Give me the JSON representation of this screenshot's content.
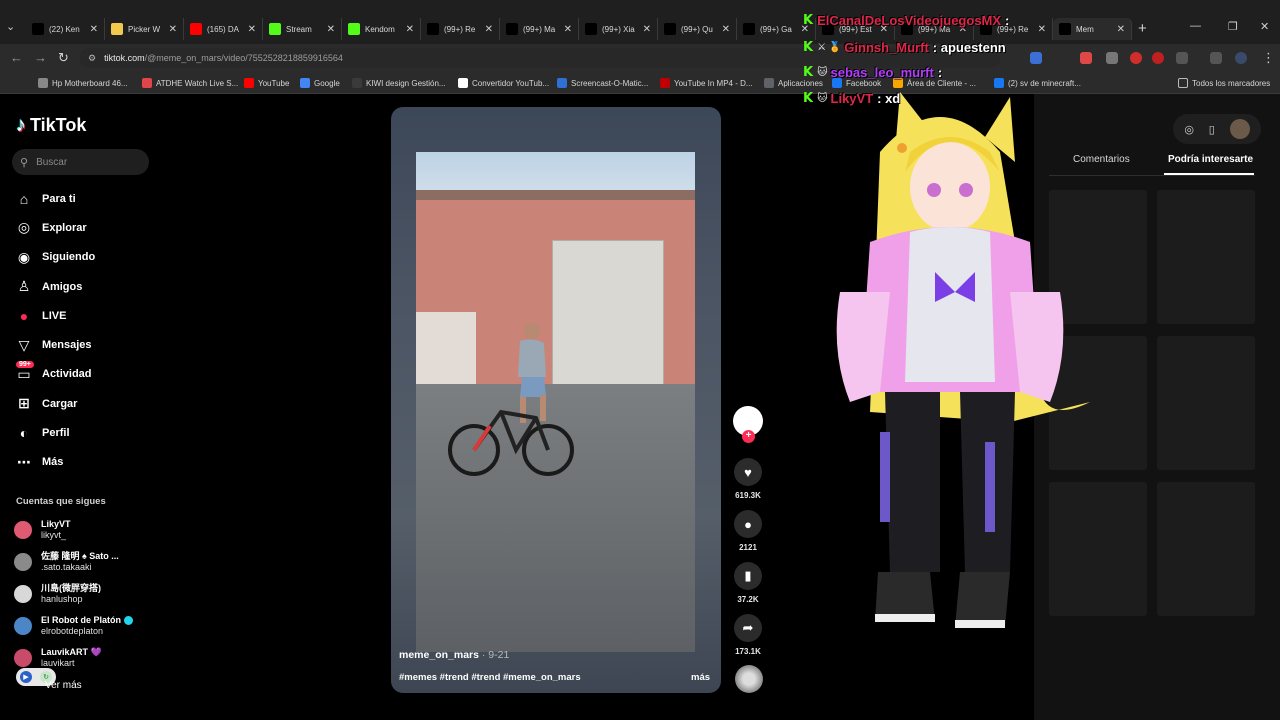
{
  "browser": {
    "tabs": [
      {
        "title": "(22) Ken",
        "icon": "x-icon",
        "color": "#000000"
      },
      {
        "title": "Picker W",
        "icon": "picker-icon",
        "color": "#f2c94c"
      },
      {
        "title": "(165) DA",
        "icon": "youtube-icon",
        "color": "#ff0000"
      },
      {
        "title": "Stream",
        "icon": "kick-icon",
        "color": "#53fc18"
      },
      {
        "title": "Kendom",
        "icon": "kick-icon",
        "color": "#53fc18"
      },
      {
        "title": "(99+) Re",
        "icon": "tiktok-icon",
        "color": "#000000"
      },
      {
        "title": "(99+) Ma",
        "icon": "tiktok-icon",
        "color": "#000000"
      },
      {
        "title": "(99+) Xia",
        "icon": "tiktok-icon",
        "color": "#000000"
      },
      {
        "title": "(99+) Qu",
        "icon": "tiktok-icon",
        "color": "#000000"
      },
      {
        "title": "(99+) Ga",
        "icon": "tiktok-icon",
        "color": "#000000"
      },
      {
        "title": "(99+) Est",
        "icon": "tiktok-icon",
        "color": "#000000"
      },
      {
        "title": "(99+) Ma",
        "icon": "tiktok-icon",
        "color": "#000000"
      },
      {
        "title": "(99+) Re",
        "icon": "tiktok-icon",
        "color": "#000000"
      },
      {
        "title": "Mem",
        "icon": "tiktok-icon",
        "color": "#000000"
      }
    ],
    "url_host": "tiktok.com",
    "url_path": "/@meme_on_mars/video/7552528218859916564",
    "bookmarks": [
      {
        "label": "Hp Motherboard 46...",
        "color": "#888888"
      },
      {
        "label": "ATDHE Watch Live S...",
        "color": "#e0454c"
      },
      {
        "label": "YouTube",
        "color": "#ff0000"
      },
      {
        "label": "Google",
        "color": "#4285f4"
      },
      {
        "label": "KIWI design Gestión...",
        "color": "#3a3a3a"
      },
      {
        "label": "Convertidor YouTub...",
        "color": "#ffffff"
      },
      {
        "label": "Screencast-O-Matic...",
        "color": "#2f6fd6"
      },
      {
        "label": "YouTube In MP4 - D...",
        "color": "#c00000"
      },
      {
        "label": "Aplicaciones",
        "color": "#5f6368"
      },
      {
        "label": "Facebook",
        "color": "#1877f2"
      },
      {
        "label": "Área de Cliente - ...",
        "color": "#f7a700"
      },
      {
        "label": "(2) sv de minecraft...",
        "color": "#1877f2"
      }
    ],
    "all_bookmarks": "Todos los marcadores"
  },
  "tiktok": {
    "logo": "TikTok",
    "search_placeholder": "Buscar",
    "nav": [
      {
        "label": "Para ti",
        "icon": "home-icon"
      },
      {
        "label": "Explorar",
        "icon": "compass-icon"
      },
      {
        "label": "Siguiendo",
        "icon": "following-icon"
      },
      {
        "label": "Amigos",
        "icon": "friends-icon"
      },
      {
        "label": "LIVE",
        "icon": "live-icon"
      },
      {
        "label": "Mensajes",
        "icon": "messages-icon"
      },
      {
        "label": "Actividad",
        "icon": "activity-icon",
        "badge": "99+"
      },
      {
        "label": "Cargar",
        "icon": "upload-icon"
      },
      {
        "label": "Perfil",
        "icon": "profile-icon"
      },
      {
        "label": "Más",
        "icon": "more-icon"
      }
    ],
    "following_title": "Cuentas que sigues",
    "following": [
      {
        "name": "LikyVT",
        "handle": "likyvt_",
        "color": "#e05a72"
      },
      {
        "name": "佐藤 隆明 ♠ Sato ...",
        "handle": ".sato.takaaki",
        "color": "#8a8a8a"
      },
      {
        "name": "川島(微胖穿搭)",
        "handle": "hanlushop",
        "color": "#d8d8d8"
      },
      {
        "name": "El Robot de Platón",
        "handle": "elrobotdeplaton",
        "color": "#4b87c6",
        "verified": true
      },
      {
        "name": "LauvikART 💜",
        "handle": "lauvikart",
        "color": "#c94b6a"
      }
    ],
    "see_more": "Ver más",
    "video": {
      "username": "meme_on_mars",
      "date": "· 9-21",
      "hashtags": "#memes #trend #trend #meme_on_mars",
      "more": "más"
    },
    "actions": {
      "likes": "619.3K",
      "comments": "2121",
      "saves": "37.2K",
      "shares": "173.1K"
    },
    "right_panel": {
      "tab_comments": "Comentarios",
      "tab_suggestions": "Podría interesarte"
    }
  },
  "stream_chat": [
    {
      "user": "ElCanalDeLosVideojuegosMX",
      "color": "#e0264a",
      "message": ":",
      "badges": ""
    },
    {
      "user": "Ginnsh_Murft",
      "color": "#e0264a",
      "message": ": apuestenn",
      "badges": "⚔ 🏅"
    },
    {
      "user": "sebas_leo_murft",
      "color": "#b43cff",
      "message": ":",
      "badges": "🐱"
    },
    {
      "user": "LikyVT",
      "color": "#e0264a",
      "message": ": xd",
      "badges": "🐱"
    }
  ]
}
